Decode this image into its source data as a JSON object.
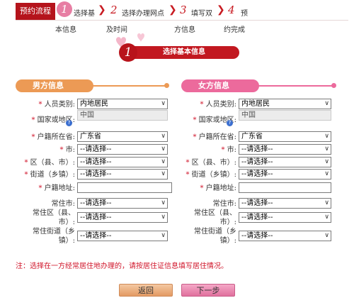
{
  "header": {
    "flow_tag": "预约流程",
    "steps": [
      {
        "num": "1",
        "label": "选择基",
        "sub": "本信息"
      },
      {
        "num": "2",
        "label": "选择办理网点",
        "sub": "及时间"
      },
      {
        "num": "3",
        "label": "填写双",
        "sub": "方信息"
      },
      {
        "num": "4",
        "label": "预",
        "sub": "约完成"
      }
    ]
  },
  "section": {
    "num": "1",
    "title": "选择基本信息"
  },
  "male": {
    "title": "男方信息",
    "person_type_label": "人员类别:",
    "person_type_value": "内地居民",
    "country_label": "国家或地区:",
    "country_value": "中国",
    "province_label": "户籍所在省:",
    "province_value": "广东省",
    "city_label": "市:",
    "city_value": "--请选择--",
    "district_label": "区（县、市）:",
    "district_value": "--请选择--",
    "street_label": "街道（乡镇）:",
    "street_value": "--请选择--",
    "address_label": "户籍地址:",
    "res_city_label": "常住市:",
    "res_city_value": "--请选择--",
    "res_district_label_1": "常住区（县、",
    "res_district_label_2": "市）:",
    "res_district_value": "--请选择--",
    "res_street_label_1": "常住街道（乡",
    "res_street_label_2": "镇）:",
    "res_street_value": "--请选择--"
  },
  "female": {
    "title": "女方信息",
    "person_type_label": "人员类别:",
    "person_type_value": "内地居民",
    "country_label": "国家或地区:",
    "country_value": "中国",
    "province_label": "户籍所在省:",
    "province_value": "广东省",
    "city_label": "市:",
    "city_value": "--请选择--",
    "district_label": "区（县、市）:",
    "district_value": "--请选择--",
    "street_label": "街道（乡镇）:",
    "street_value": "--请选择--",
    "address_label": "户籍地址:",
    "res_city_label": "常住市:",
    "res_city_value": "--请选择--",
    "res_district_label_1": "常住区（县、",
    "res_district_label_2": "市）:",
    "res_district_value": "--请选择--",
    "res_street_label_1": "常住街道（乡",
    "res_street_label_2": "镇）:",
    "res_street_value": "--请选择--"
  },
  "note": "注：选择在一方经常居住地办理的，请按居住证信息填写居住情况。",
  "buttons": {
    "back": "返回",
    "next": "下一步"
  },
  "colors": {
    "brand_red": "#c21820",
    "male_orange": "#ec9a55",
    "female_pink": "#ec6a9c"
  },
  "icons": {
    "help": "help-icon",
    "dropdown": "chevron-down-icon",
    "hearts": "hearts-decoration"
  }
}
